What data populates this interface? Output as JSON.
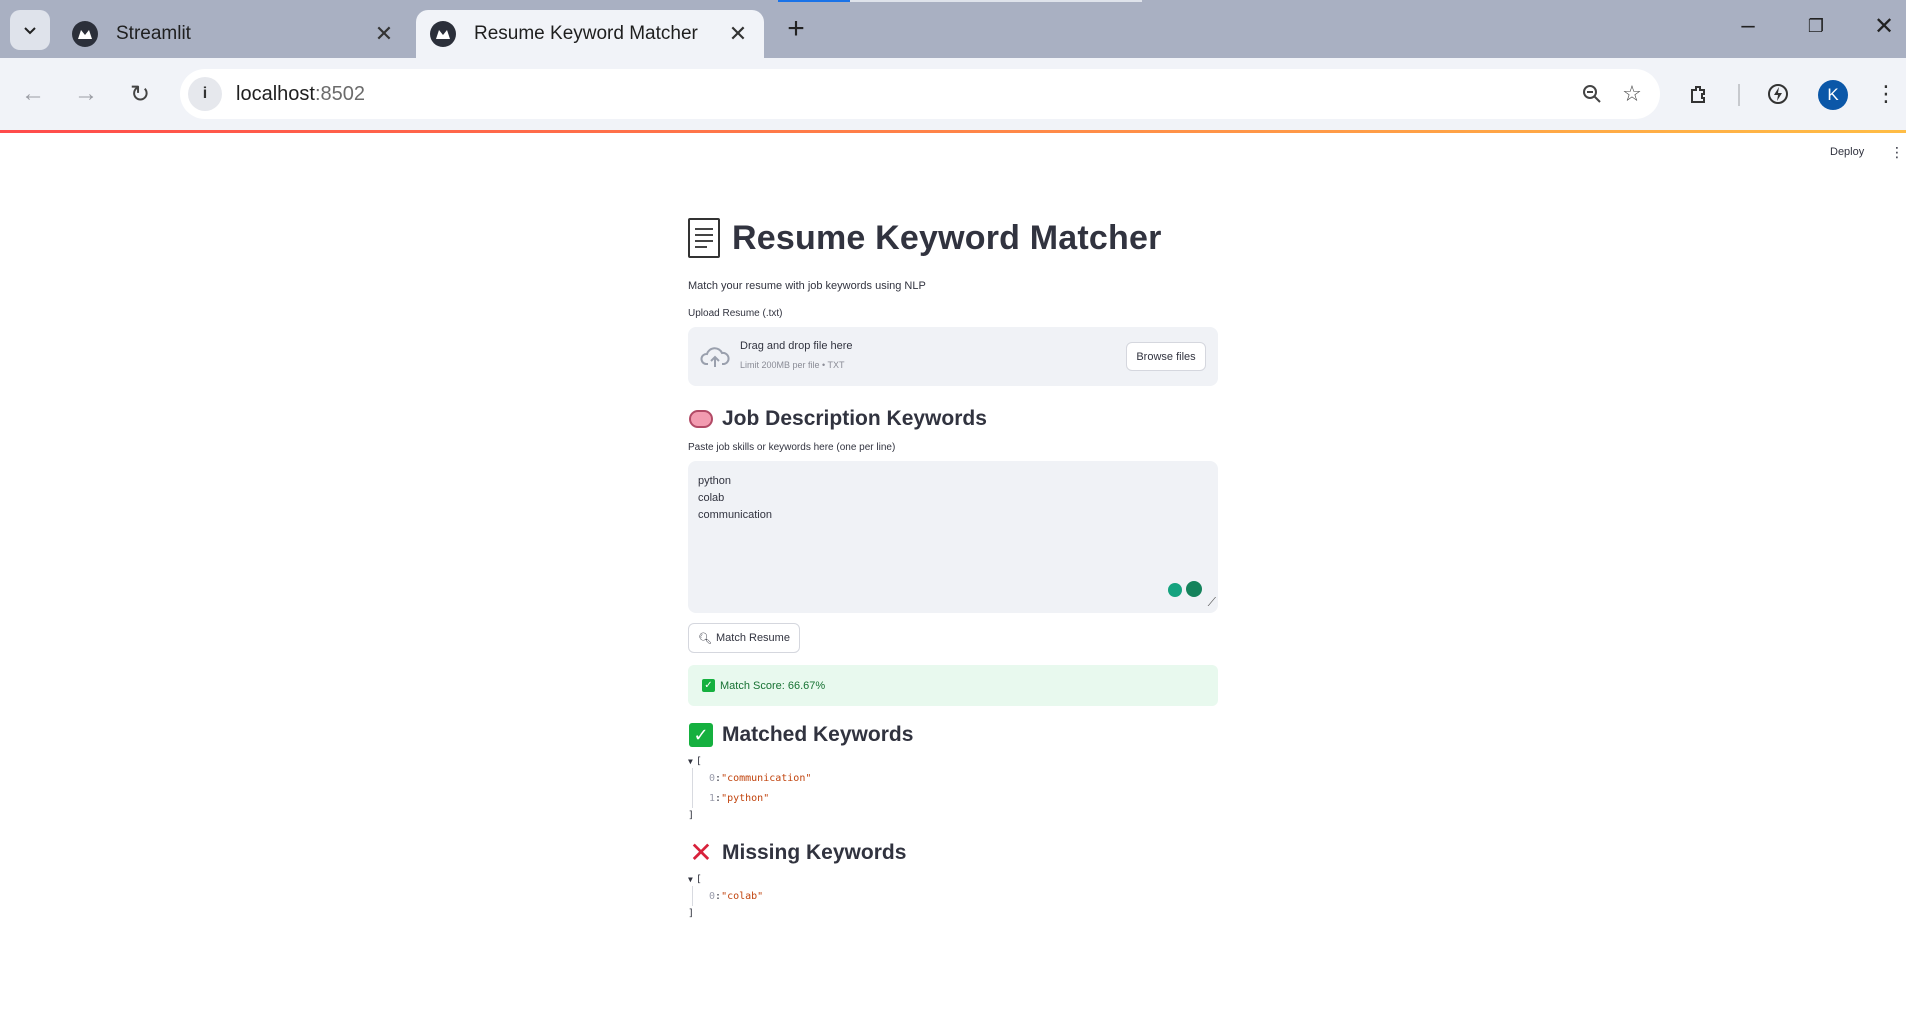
{
  "browser": {
    "tabs": [
      {
        "title": "Streamlit",
        "active": false
      },
      {
        "title": "Resume Keyword Matcher",
        "active": true
      }
    ],
    "url_host": "localhost",
    "url_port": ":8502",
    "profile_initial": "K",
    "icons": [
      "tab-search-icon",
      "back-icon",
      "forward-icon",
      "reload-icon",
      "info-icon",
      "zoom-icon",
      "star-icon",
      "extensions-icon",
      "performance-icon",
      "menu-icon"
    ]
  },
  "header": {
    "deploy_label": "Deploy",
    "menu_glyph": "⋮"
  },
  "page": {
    "title": "Resume Keyword Matcher",
    "caption": "Match your resume with job keywords using NLP",
    "uploader": {
      "label": "Upload Resume (.txt)",
      "drag_text": "Drag and drop file here",
      "limit_text": "Limit 200MB per file • TXT",
      "browse_label": "Browse files"
    },
    "keywords_section": {
      "heading": "Job Description Keywords",
      "textarea_label": "Paste job skills or keywords here (one per line)",
      "textarea_lines": [
        "python",
        "colab",
        "communication"
      ]
    },
    "match_button_label": "Match Resume",
    "success_text": "Match Score: 66.67%",
    "matched": {
      "heading": "Matched Keywords",
      "items": [
        {
          "index": "0",
          "value": "\"communication\""
        },
        {
          "index": "1",
          "value": "\"python\""
        }
      ]
    },
    "missing": {
      "heading": "Missing Keywords",
      "items": [
        {
          "index": "0",
          "value": "\"colab\""
        }
      ]
    },
    "json_open": "[",
    "json_close": "]",
    "json_sep": " : "
  },
  "colors": {
    "accent_gradient_start": "#ff4b4b",
    "accent_gradient_end": "#ffbd45",
    "success_bg": "#e8f9ee",
    "success_text": "#177233",
    "json_string": "#c1440e"
  }
}
